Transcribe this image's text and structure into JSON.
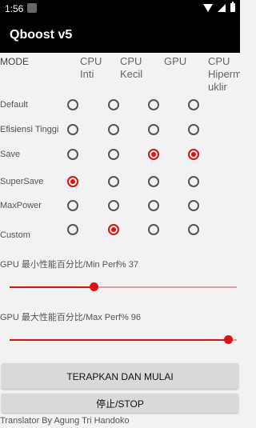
{
  "status_bar": {
    "time": "1:56"
  },
  "app": {
    "title": "Qboost v5"
  },
  "grid": {
    "headers": {
      "mode": "MODE",
      "cpu_inti": "CPU\nInti",
      "cpu_kecil": "CPU\nKecil",
      "gpu": "GPU",
      "cpu_hiper": "CPU\nHiperm\nuklir"
    },
    "rows": [
      {
        "label": "Default",
        "cpu_inti": false,
        "cpu_kecil": false,
        "gpu": false,
        "cpu_hiper": false
      },
      {
        "label": "Efisiensi Tinggi",
        "cpu_inti": false,
        "cpu_kecil": false,
        "gpu": false,
        "cpu_hiper": false
      },
      {
        "label": "Save",
        "cpu_inti": false,
        "cpu_kecil": false,
        "gpu": true,
        "cpu_hiper": true
      },
      {
        "label": "SuperSave",
        "cpu_inti": true,
        "cpu_kecil": false,
        "gpu": false,
        "cpu_hiper": false
      },
      {
        "label": "MaxPower",
        "cpu_inti": false,
        "cpu_kecil": false,
        "gpu": false,
        "cpu_hiper": false
      },
      {
        "label": "Custom",
        "cpu_inti": false,
        "cpu_kecil": true,
        "gpu": false,
        "cpu_hiper": false
      }
    ]
  },
  "sliders": {
    "min_label": "GPU 最小性能百分比/Min Perf% 37",
    "min_value": 37,
    "max_label": "GPU 最大性能百分比/Max Perf% 96",
    "max_value": 96
  },
  "buttons": {
    "apply": "TERAPKAN DAN MULAI",
    "stop": "停止/STOP"
  },
  "footer": "Translator By Agung Tri Handoko",
  "colors": {
    "accent": "#e01010",
    "appbar": "#000000"
  }
}
